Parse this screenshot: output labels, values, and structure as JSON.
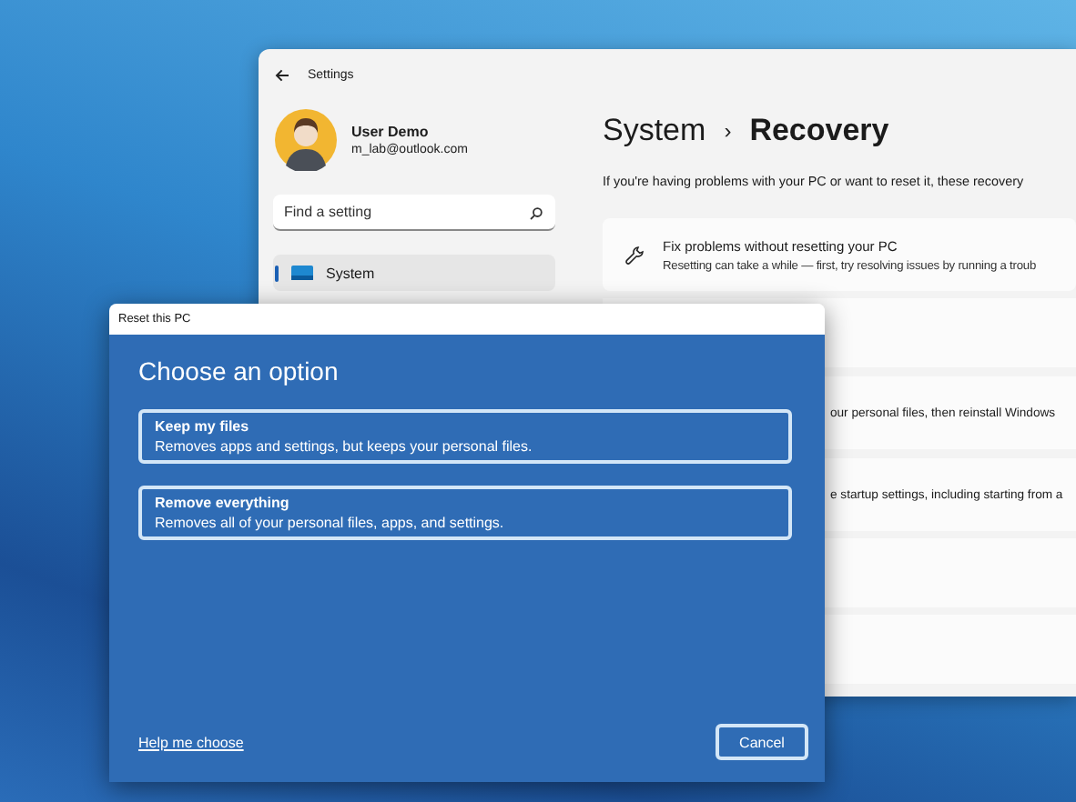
{
  "settings_window": {
    "title": "Settings",
    "user": {
      "name": "User Demo",
      "email": "m_lab@outlook.com"
    },
    "search": {
      "placeholder": "Find a setting"
    },
    "nav_items": [
      {
        "label": "System",
        "selected": true
      }
    ],
    "heading": {
      "section": "System",
      "separator": "›",
      "page": "Recovery"
    },
    "description": "If you're having problems with your PC or want to reset it, these recovery",
    "cards": [
      {
        "title": "Fix problems without resetting your PC",
        "description": "Resetting can take a while — first, try resolving issues by running a troub"
      }
    ],
    "partial_rows": [
      "our personal files, then reinstall Windows",
      "e startup settings, including starting from a"
    ]
  },
  "dialog": {
    "title": "Reset this PC",
    "heading": "Choose an option",
    "options": [
      {
        "title": "Keep my files",
        "description": "Removes apps and settings, but keeps your personal files."
      },
      {
        "title": "Remove everything",
        "description": "Removes all of your personal files, apps, and settings."
      }
    ],
    "link": "Help me choose",
    "button": "Cancel"
  }
}
